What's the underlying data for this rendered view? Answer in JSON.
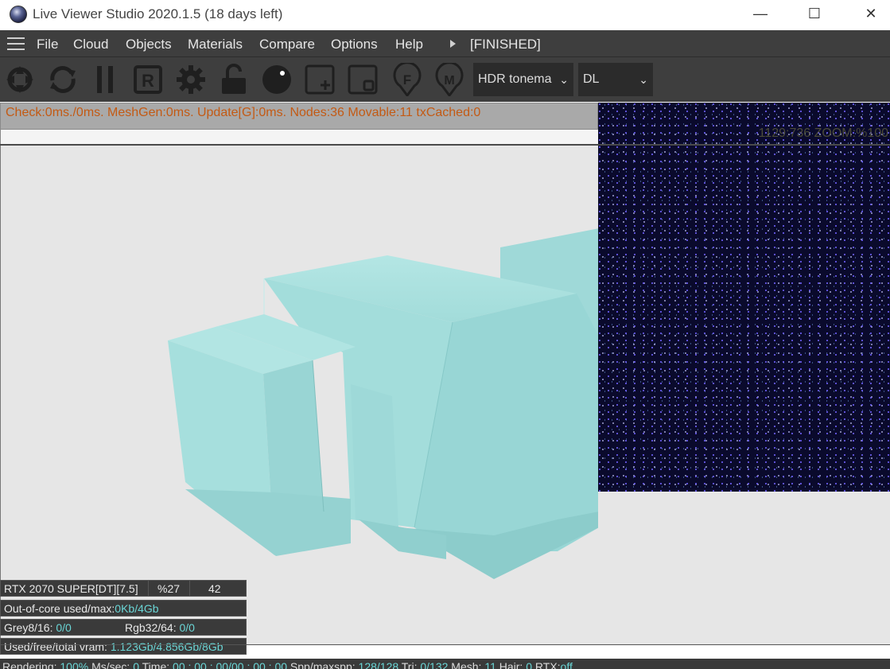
{
  "window": {
    "title": "Live Viewer Studio 2020.1.5 (18 days left)",
    "minimize_glyph": "—",
    "maximize_glyph": "☐",
    "close_glyph": "✕"
  },
  "menu": {
    "items": [
      "File",
      "Cloud",
      "Objects",
      "Materials",
      "Compare",
      "Options",
      "Help"
    ],
    "status": "[FINISHED]"
  },
  "toolbar": {
    "icons": [
      "camera-lens-icon",
      "refresh-icon",
      "pause-icon",
      "r-button-icon",
      "gear-icon",
      "unlock-icon",
      "sphere-icon",
      "add-region-icon",
      "region-icon",
      "f-pin-icon",
      "m-pin-icon"
    ],
    "r_letter": "R",
    "f_letter": "F",
    "m_letter": "M",
    "tonemap_select": "HDR tonema",
    "kernel_select": "DL"
  },
  "stats": {
    "line": "Check:0ms./0ms. MeshGen:0ms. Update[G]:0ms. Nodes:36 Movable:11 txCached:0"
  },
  "preview": {
    "caption": "1129:736 ZOOM:%100"
  },
  "info": {
    "gpu_name": "RTX 2070 SUPER[DT][7.5]",
    "gpu_usage": "%27",
    "gpu_temp": "42",
    "ooc_label": "Out-of-core used/max:",
    "ooc_value": "0Kb/4Gb",
    "grey_label": "Grey8/16: ",
    "grey_value": "0/0",
    "rgb_label": "Rgb32/64: ",
    "rgb_value": "0/0",
    "vram_label": "Used/free/total vram: ",
    "vram_value": "1.123Gb/4.856Gb/8Gb"
  },
  "status": {
    "rendering_label": "Rendering: ",
    "rendering_value": "100%",
    "mssec_label": " Ms/sec: ",
    "mssec_value": "0",
    "time_label": "   Time: ",
    "time_value": "00 : 00 : 00/00 : 00 : 00",
    "spp_label": "     Spp/maxspp: ",
    "spp_value": "128/128",
    "tri_label": "   Tri: ",
    "tri_value": "0/132",
    "mesh_label": "   Mesh: ",
    "mesh_value": "11",
    "hair_label": "   Hair: ",
    "hair_value": "0",
    "rtx_label": "   RTX:",
    "rtx_value": "off"
  },
  "colors": {
    "accent_cyan": "#6ad6d6",
    "stats_orange": "#c35a14",
    "model_teal": "#9fdcdc"
  }
}
